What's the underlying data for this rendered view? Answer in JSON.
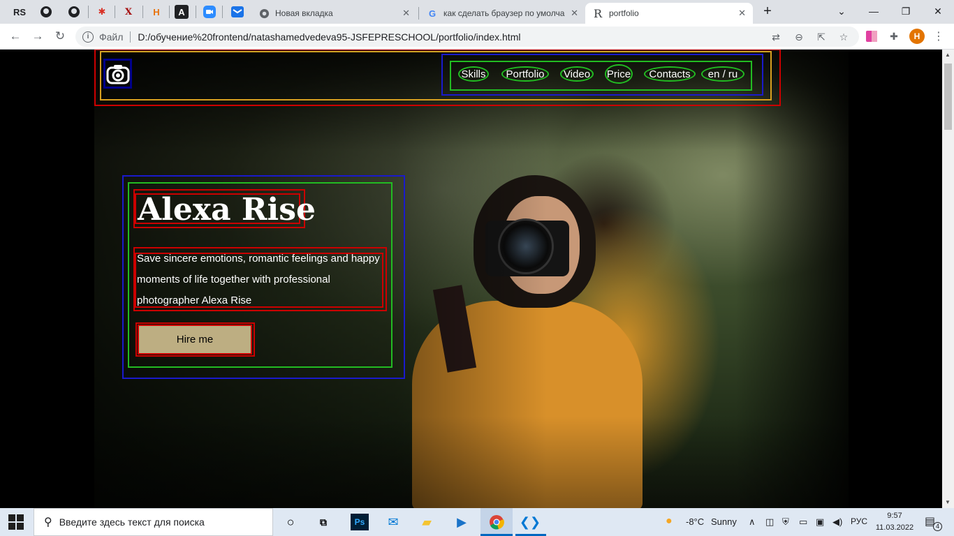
{
  "browser": {
    "bookmarks": [
      "RS",
      "GitHub",
      "GitHub",
      "App",
      "X",
      "H",
      "A",
      "Zoom",
      "Mail"
    ],
    "tabs": [
      {
        "title": "Новая вкладка",
        "favicon": "chrome-icon"
      },
      {
        "title": "как сделать браузер по умолчанию",
        "favicon": "google-icon"
      },
      {
        "title": "portfolio",
        "favicon": "R"
      }
    ],
    "address": {
      "security_label": "Файл",
      "url": "D:/обучение%20frontend/natashamedvedeva95-JSFEPRESCHOOL/portfolio/index.html"
    },
    "profile_initial": "H"
  },
  "page": {
    "nav": [
      "Skills",
      "Portfolio",
      "Video",
      "Price",
      "Contacts"
    ],
    "lang": "en / ru",
    "title": "Alexa Rise",
    "description": "Save sincere emotions, romantic feelings and happy moments of life together with professional photographer Alexa Rise",
    "cta": "Hire me"
  },
  "taskbar": {
    "search_placeholder": "Введите здесь текст для поиска",
    "weather_temp": "-8°C",
    "weather_text": "Sunny",
    "lang": "РУС",
    "time": "9:57",
    "date": "11.03.2022",
    "notifications": "4"
  },
  "colors": {
    "debug_red": "#cc0000",
    "debug_blue": "#1a1acc",
    "debug_green": "#22bb22",
    "debug_orange": "#d8a020",
    "button_bg": "#bdae82"
  }
}
